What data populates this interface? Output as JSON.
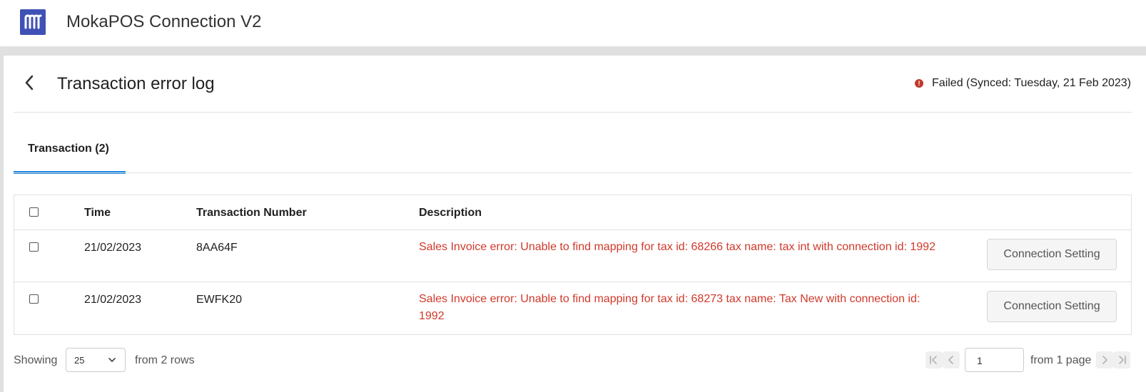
{
  "app": {
    "title": "MokaPOS Connection V2"
  },
  "page": {
    "title": "Transaction error log",
    "status": "Failed (Synced: Tuesday, 21 Feb 2023)"
  },
  "tabs": [
    {
      "label": "Transaction (2)",
      "active": true
    }
  ],
  "table": {
    "headers": {
      "time": "Time",
      "transaction_number": "Transaction Number",
      "description": "Description"
    },
    "rows": [
      {
        "time": "21/02/2023",
        "transaction_number": "8AA64F",
        "description": "Sales Invoice error: Unable to find mapping for tax id: 68266 tax name: tax int with connection id: 1992",
        "action": "Connection Setting"
      },
      {
        "time": "21/02/2023",
        "transaction_number": "EWFK20",
        "description": "Sales Invoice error: Unable to find mapping for tax id: 68273 tax name: Tax New with connection id: 1992",
        "action": "Connection Setting"
      }
    ]
  },
  "footer": {
    "showing_label": "Showing",
    "page_size": "25",
    "rows_label": "from 2 rows",
    "current_page": "1",
    "pages_label": "from 1 page"
  },
  "colors": {
    "brand": "#3f51b5",
    "accent": "#1e88e5",
    "error": "#d0392b"
  },
  "icons": [
    "logo-icon",
    "back-arrow-icon",
    "error-icon",
    "chevron-down-icon",
    "first-page-icon",
    "prev-page-icon",
    "next-page-icon",
    "last-page-icon"
  ]
}
